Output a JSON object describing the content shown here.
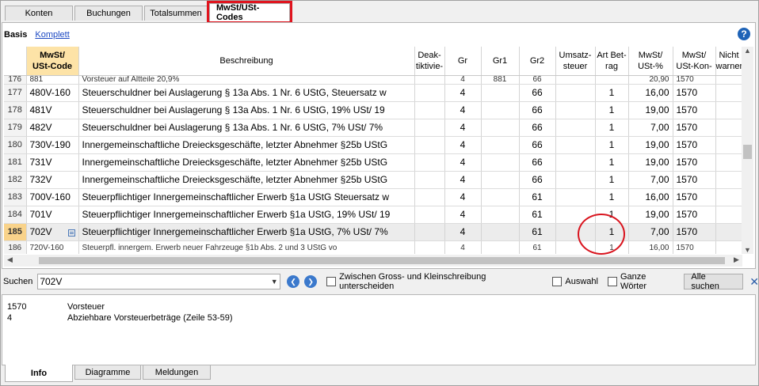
{
  "tabs": [
    "Konten",
    "Buchungen",
    "Totalsummen",
    "MwSt/USt-Codes"
  ],
  "view": {
    "title": "Basis",
    "link": "Komplett",
    "help": "?"
  },
  "columns": [
    {
      "label": "MwSt/\nUSt-Code"
    },
    {
      "label": "Beschreibung"
    },
    {
      "label": "Deak-\ntiktivie-"
    },
    {
      "label": "Gr"
    },
    {
      "label": "Gr1"
    },
    {
      "label": "Gr2"
    },
    {
      "label": "Umsatz-\nsteuer"
    },
    {
      "label": "Art Bet-\nrag"
    },
    {
      "label": "MwSt/\nUSt-%"
    },
    {
      "label": "MwSt/\nUSt-Kon-"
    },
    {
      "label": "Nicht\nwarnen"
    }
  ],
  "rows": [
    {
      "n": "176",
      "code": "881",
      "desc": "Vorsteuer auf Altteile 20,9%",
      "gr": "4",
      "gr1": "881",
      "gr2": "66",
      "art": "",
      "pct": "20,90",
      "konto": "1570",
      "partial": "top"
    },
    {
      "n": "177",
      "code": "480V-160",
      "desc": "Steuerschuldner bei Auslagerung § 13a Abs. 1 Nr. 6 UStG, Steuersatz w",
      "gr": "4",
      "gr1": "",
      "gr2": "66",
      "art": "1",
      "pct": "16,00",
      "konto": "1570"
    },
    {
      "n": "178",
      "code": "481V",
      "desc": "Steuerschuldner bei Auslagerung § 13a Abs. 1 Nr. 6 UStG, 19% USt/ 19",
      "gr": "4",
      "gr1": "",
      "gr2": "66",
      "art": "1",
      "pct": "19,00",
      "konto": "1570"
    },
    {
      "n": "179",
      "code": "482V",
      "desc": "Steuerschuldner bei Auslagerung § 13a Abs. 1 Nr. 6 UStG, 7% USt/ 7%",
      "gr": "4",
      "gr1": "",
      "gr2": "66",
      "art": "1",
      "pct": "7,00",
      "konto": "1570"
    },
    {
      "n": "180",
      "code": "730V-190",
      "desc": "Innergemeinschaftliche Dreiecksgeschäfte, letzter Abnehmer §25b UStG",
      "gr": "4",
      "gr1": "",
      "gr2": "66",
      "art": "1",
      "pct": "19,00",
      "konto": "1570"
    },
    {
      "n": "181",
      "code": "731V",
      "desc": "Innergemeinschaftliche Dreiecksgeschäfte, letzter Abnehmer §25b UStG",
      "gr": "4",
      "gr1": "",
      "gr2": "66",
      "art": "1",
      "pct": "19,00",
      "konto": "1570"
    },
    {
      "n": "182",
      "code": "732V",
      "desc": "Innergemeinschaftliche Dreiecksgeschäfte, letzter Abnehmer §25b UStG",
      "gr": "4",
      "gr1": "",
      "gr2": "66",
      "art": "1",
      "pct": "7,00",
      "konto": "1570"
    },
    {
      "n": "183",
      "code": "700V-160",
      "desc": "Steuerpflichtiger Innergemeinschaftlicher Erwerb §1a UStG Steuersatz w",
      "gr": "4",
      "gr1": "",
      "gr2": "61",
      "art": "1",
      "pct": "16,00",
      "konto": "1570"
    },
    {
      "n": "184",
      "code": "701V",
      "desc": "Steuerpflichtiger Innergemeinschaftlicher Erwerb §1a UStG, 19% USt/ 19",
      "gr": "4",
      "gr1": "",
      "gr2": "61",
      "art": "1",
      "pct": "19,00",
      "konto": "1570"
    },
    {
      "n": "185",
      "code": "702V",
      "desc": "Steuerpflichtiger Innergemeinschaftlicher Erwerb §1a UStG, 7% USt/ 7%",
      "gr": "4",
      "gr1": "",
      "gr2": "61",
      "art": "1",
      "pct": "7,00",
      "konto": "1570",
      "selected": true
    },
    {
      "n": "186",
      "code": "720V-160",
      "desc": "Steuerpfl. innergem. Erwerb neuer Fahrzeuge §1b Abs. 2 und 3 UStG vo",
      "gr": "4",
      "gr1": "",
      "gr2": "61",
      "art": "1",
      "pct": "16,00",
      "konto": "1570",
      "partial": "bottom"
    }
  ],
  "search": {
    "label": "Suchen",
    "value": "702V",
    "match_case": "Zwischen Gross- und Kleinschreibung unterscheiden",
    "selection": "Auswahl",
    "whole_words": "Ganze Wörter",
    "find_all": "Alle suchen",
    "close": "✕"
  },
  "info": [
    {
      "a": "1570",
      "b": "Vorsteuer"
    },
    {
      "a": "4",
      "b": "Abziehbare Vorsteuerbeträge (Zeile 53-59)"
    }
  ],
  "bottom_tabs": [
    "Info",
    "Diagramme",
    "Meldungen"
  ]
}
